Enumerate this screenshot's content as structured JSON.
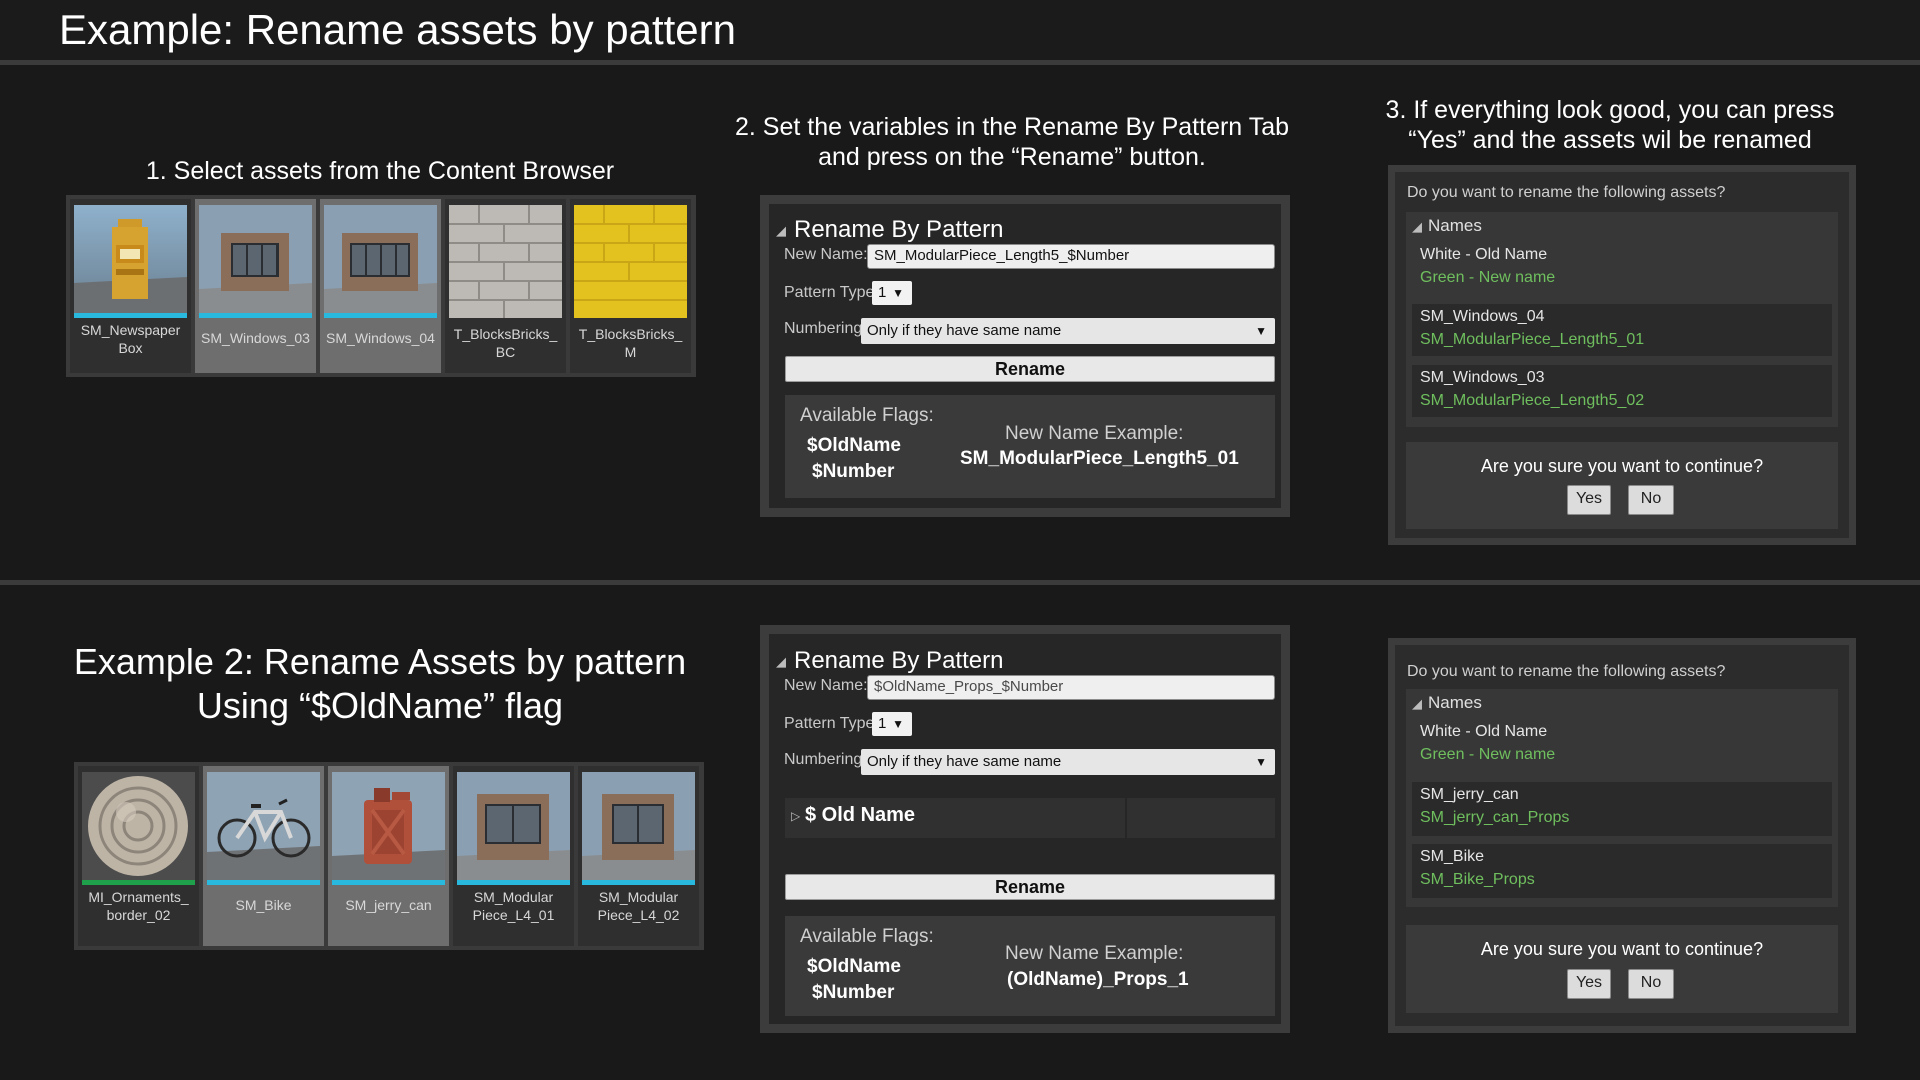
{
  "header": {
    "title": "Example: Rename assets by pattern"
  },
  "colors": {
    "background": "#191919",
    "panel": "#3c3c3c",
    "new_name_green": "#6fbf5e",
    "selection_underline": "#29b9df"
  },
  "example1": {
    "step1": "1. Select assets from the Content Browser",
    "step2": [
      "2. Set the variables in the Rename By Pattern Tab",
      "and press on the “Rename” button."
    ],
    "step3": [
      "3. If everything look good, you can press",
      "“Yes” and the assets wil be renamed"
    ],
    "assets": [
      {
        "name": [
          "SM_Newspaper",
          "Box"
        ],
        "icon": "newspaper-box-icon",
        "selected": false
      },
      {
        "name": [
          "SM_Windows_03"
        ],
        "icon": "window-icon",
        "selected": true
      },
      {
        "name": [
          "SM_Windows_04"
        ],
        "icon": "window-icon",
        "selected": true
      },
      {
        "name": [
          "T_BlocksBricks_",
          "BC"
        ],
        "icon": "brick-texture-icon",
        "selected": false
      },
      {
        "name": [
          "T_BlocksBricks_",
          "M"
        ],
        "icon": "yellow-texture-icon",
        "selected": false
      }
    ],
    "panel": {
      "title": "Rename By Pattern",
      "new_name_label": "New Name:",
      "new_name_value": "SM_ModularPiece_Length5_$Number",
      "pattern_type_label": "Pattern Type:",
      "pattern_type_value": "1",
      "numbering_label": "Numbering:",
      "numbering_value": "Only if they have same name",
      "rename_button": "Rename",
      "flags_header": "Available Flags:",
      "flags": [
        "$OldName",
        "$Number"
      ],
      "example_header": "New Name Example:",
      "example_value": "SM_ModularPiece_Length5_01"
    },
    "dialog": {
      "question": "Do you want to rename the following assets?",
      "names_header": "Names",
      "legend_old": "White - Old Name",
      "legend_new": "Green - New name",
      "rows": [
        {
          "old": "SM_Windows_04",
          "new": "SM_ModularPiece_Length5_01"
        },
        {
          "old": "SM_Windows_03",
          "new": "SM_ModularPiece_Length5_02"
        }
      ],
      "confirm": "Are you sure you want to continue?",
      "yes": "Yes",
      "no": "No"
    }
  },
  "example2": {
    "title": [
      "Example 2: Rename Assets by pattern",
      "Using “$OldName” flag"
    ],
    "assets": [
      {
        "name": [
          "MI_Ornaments_",
          "border_02"
        ],
        "icon": "ornament-sphere-icon",
        "selected": false
      },
      {
        "name": [
          "SM_Bike"
        ],
        "icon": "bike-icon",
        "selected": true
      },
      {
        "name": [
          "SM_jerry_can"
        ],
        "icon": "jerry-can-icon",
        "selected": true
      },
      {
        "name": [
          "SM_Modular",
          "Piece_L4_01"
        ],
        "icon": "window-icon",
        "selected": false
      },
      {
        "name": [
          "SM_Modular",
          "Piece_L4_02"
        ],
        "icon": "window-icon",
        "selected": false
      }
    ],
    "panel": {
      "title": "Rename By Pattern",
      "new_name_label": "New Name:",
      "new_name_value": "$OldName_Props_$Number",
      "pattern_type_label": "Pattern Type:",
      "pattern_type_value": "1",
      "numbering_label": "Numbering:",
      "numbering_value": "Only if they have same name",
      "old_name_row": "$ Old Name",
      "rename_button": "Rename",
      "flags_header": "Available Flags:",
      "flags": [
        "$OldName",
        "$Number"
      ],
      "example_header": "New Name Example:",
      "example_value": "(OldName)_Props_1"
    },
    "dialog": {
      "question": "Do you want to rename the following assets?",
      "names_header": "Names",
      "legend_old": "White - Old Name",
      "legend_new": "Green - New name",
      "rows": [
        {
          "old": "SM_jerry_can",
          "new": "SM_jerry_can_Props"
        },
        {
          "old": "SM_Bike",
          "new": "SM_Bike_Props"
        }
      ],
      "confirm": "Are you sure you want to continue?",
      "yes": "Yes",
      "no": "No"
    }
  }
}
